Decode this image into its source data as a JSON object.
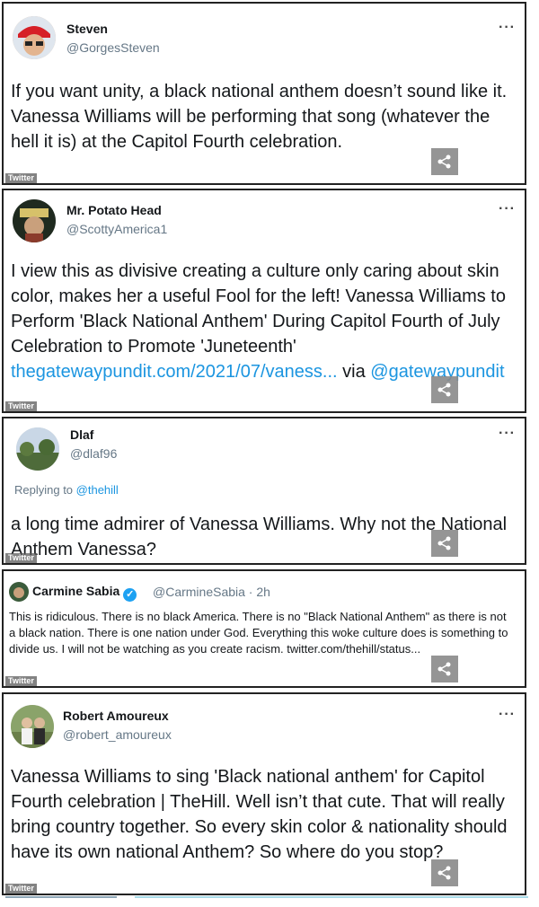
{
  "watermark": "Twitter",
  "tweets": [
    {
      "name": "Steven",
      "handle": "@GorgesSteven",
      "text": "If you want unity, a black national anthem doesn’t sound like it. Vanessa Williams will be performing that song (whatever the hell it is) at the Capitol Fourth celebration."
    },
    {
      "name": "Mr. Potato Head",
      "handle": "@ScottyAmerica1",
      "text": "I view this as divisive creating a culture only caring about skin color, makes her a useful Fool for the left! Vanessa Williams to Perform 'Black National Anthem' During Capitol Fourth of July Celebration to Promote 'Juneteenth' ",
      "link": "thegatewaypundit.com/2021/07/vaness...",
      "via_prefix": " via ",
      "via_handle": "@gatewaypundit"
    },
    {
      "name": "Dlaf",
      "handle": "@dlaf96",
      "reply_prefix": "Replying to ",
      "reply_to": "@thehill",
      "text": "a long time admirer of Vanessa Williams. Why not the National Anthem Vanessa?"
    },
    {
      "name": "Carmine Sabia",
      "handle": "@CarmineSabia · 2h",
      "verified_mark": "✓",
      "text": "This is ridiculous. There is no black America. There is no \"Black National Anthem\" as there is not a black nation. There is one nation under God. Everything this woke culture does is something to divide us. I will not be watching as you create racism. twitter.com/thehill/status..."
    },
    {
      "name": "Robert Amoureux",
      "handle": "@robert_amoureux",
      "text": "Vanessa Williams to sing 'Black national anthem' for Capitol Fourth celebration | TheHill. Well isn’t that cute. That will really bring country together. So every skin color & nationality should have its own national Anthem? So where do you stop?"
    }
  ],
  "more_label": "···",
  "colors": {
    "link": "#1b95e0",
    "verified": "#1da1f2",
    "handle": "#657786"
  }
}
